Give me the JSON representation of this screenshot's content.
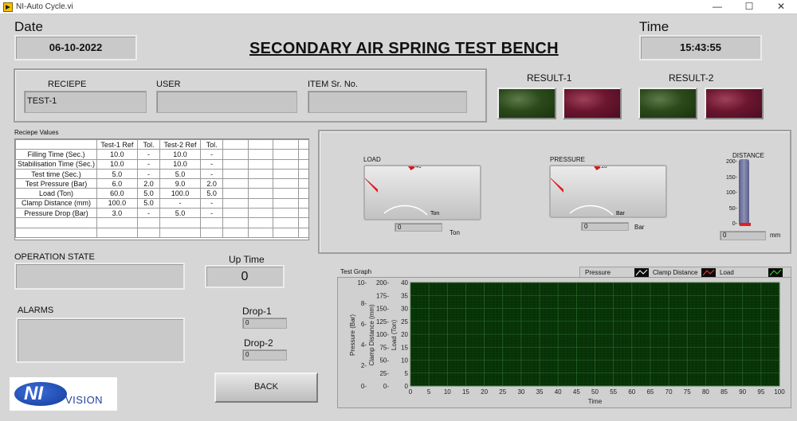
{
  "window": {
    "title": "NI-Auto Cycle.vi",
    "minimize": "—",
    "maximize": "☐",
    "close": "✕"
  },
  "header": {
    "date_label": "Date",
    "date_value": "06-10-2022",
    "title": "SECONDARY AIR SPRING TEST BENCH",
    "time_label": "Time",
    "time_value": "15:43:55"
  },
  "info": {
    "recipe_label": "RECIEPE",
    "recipe_value": "TEST-1",
    "user_label": "USER",
    "user_value": "",
    "item_label": "ITEM Sr. No.",
    "item_value": ""
  },
  "results": {
    "result1_label": "RESULT-1",
    "result2_label": "RESULT-2"
  },
  "recipe_values": {
    "caption": "Reciepe Values",
    "headers": [
      "",
      "Test-1 Ref",
      "Tol.",
      "Test-2 Ref",
      "Tol.",
      "",
      "",
      "",
      ""
    ],
    "rows": [
      [
        "Filling Time (Sec.)",
        "10.0",
        "-",
        "10.0",
        "-"
      ],
      [
        "Stabilisation Time (Sec.)",
        "10.0",
        "-",
        "10.0",
        "-"
      ],
      [
        "Test time (Sec.)",
        "5.0",
        "-",
        "5.0",
        "-"
      ],
      [
        "Test Pressure (Bar)",
        "6.0",
        "2.0",
        "9.0",
        "2.0"
      ],
      [
        "Load (Ton)",
        "60.0",
        "5.0",
        "100.0",
        "5.0"
      ],
      [
        "Clamp Distance (mm)",
        "100.0",
        "5.0",
        "-",
        "-"
      ],
      [
        "Pressure Drop (Bar)",
        "3.0",
        "-",
        "5.0",
        "-"
      ]
    ]
  },
  "load_gauge": {
    "label": "LOAD",
    "unit": "Ton",
    "value": 0,
    "readout": "0",
    "readout_unit": "Ton",
    "ticks": [
      "0",
      "5",
      "10",
      "15",
      "20",
      "25",
      "30",
      "35",
      "40"
    ],
    "max": 40
  },
  "pressure_gauge": {
    "label": "PRESSURE",
    "unit": "Bar",
    "value": 0,
    "readout": "0",
    "readout_unit": "Bar",
    "ticks": [
      "0",
      "1",
      "2",
      "3",
      "4",
      "5",
      "6",
      "7",
      "8",
      "9",
      "10"
    ],
    "max": 10
  },
  "distance": {
    "label": "DISTANCE",
    "value": 0,
    "readout": "0",
    "unit": "mm",
    "ticks": [
      "200",
      "150",
      "100",
      "50",
      "0"
    ]
  },
  "operation": {
    "label": "OPERATION STATE",
    "value": ""
  },
  "uptime": {
    "label": "Up Time",
    "value": "0"
  },
  "alarms": {
    "label": "ALARMS",
    "value": ""
  },
  "drops": {
    "drop1_label": "Drop-1",
    "drop1_value": "0",
    "drop2_label": "Drop-2",
    "drop2_value": "0"
  },
  "back_button": "BACK",
  "logo": {
    "text_ni": "NI",
    "text_vision": "VISION"
  },
  "colors": {
    "plot_bg": "#063006",
    "grid": "#2c6a2c",
    "pressure": "#ffffff",
    "clamp": "#ff3333",
    "load": "#33dd33"
  },
  "chart_data": {
    "type": "line",
    "title": "Test Graph",
    "xlabel": "Time",
    "ylabels": [
      "Pressure (Bar)",
      "Clamp Distance (mm)",
      "Load (Ton)"
    ],
    "x_ticks": [
      "0",
      "5",
      "10",
      "15",
      "20",
      "25",
      "30",
      "35",
      "40",
      "45",
      "50",
      "55",
      "60",
      "65",
      "70",
      "75",
      "80",
      "85",
      "90",
      "95",
      "100"
    ],
    "xlim": [
      0,
      100
    ],
    "y_axes": [
      {
        "name": "Pressure (Bar)",
        "ylim": [
          0,
          10
        ],
        "ticks": [
          "10-",
          "8-",
          "6-",
          "4-",
          "2-",
          "0-"
        ]
      },
      {
        "name": "Clamp Distance (mm)",
        "ylim": [
          0,
          200
        ],
        "ticks": [
          "200-",
          "175-",
          "150-",
          "125-",
          "100-",
          "75-",
          "50-",
          "25-",
          "0-"
        ]
      },
      {
        "name": "Load (Ton)",
        "ylim": [
          0,
          40
        ],
        "ticks": [
          "40",
          "35",
          "30",
          "25",
          "20",
          "15",
          "10",
          "5",
          "0"
        ]
      }
    ],
    "series": [
      {
        "name": "Pressure",
        "values": []
      },
      {
        "name": "Clamp Distance",
        "values": []
      },
      {
        "name": "Load",
        "values": []
      }
    ],
    "grid": true,
    "legend": "top-right"
  }
}
